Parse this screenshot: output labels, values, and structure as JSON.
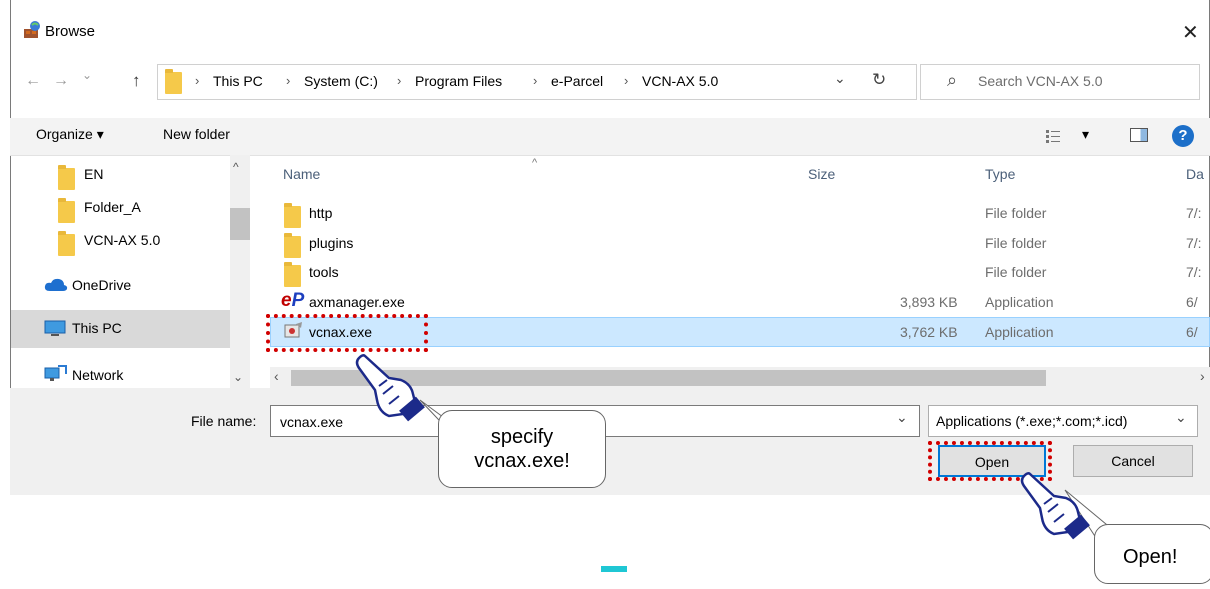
{
  "window": {
    "title": "Browse",
    "close_glyph": "✕"
  },
  "nav": {
    "back": "←",
    "forward": "→",
    "recent": "⌄",
    "up": "↑"
  },
  "breadcrumb": [
    "This PC",
    "System (C:)",
    "Program Files",
    "e-Parcel",
    "VCN-AX 5.0"
  ],
  "address_sep": "›",
  "address_dropdown": "⌄",
  "refresh_glyph": "↻",
  "search": {
    "placeholder": "Search VCN-AX 5.0",
    "icon": "⌕"
  },
  "toolbar": {
    "organize": "Organize ▾",
    "new_folder": "New folder",
    "view_arrow": "▾",
    "help": "?"
  },
  "sidebar": [
    {
      "label": "EN",
      "icon": "folder-icon"
    },
    {
      "label": "Folder_A",
      "icon": "folder-icon"
    },
    {
      "label": "VCN-AX 5.0",
      "icon": "folder-icon"
    },
    {
      "label": "OneDrive",
      "icon": "cloud-icon"
    },
    {
      "label": "This PC",
      "icon": "computer-icon"
    },
    {
      "label": "Network",
      "icon": "network-icon"
    }
  ],
  "columns": {
    "name": "Name",
    "size": "Size",
    "type": "Type",
    "date": "Da"
  },
  "files": [
    {
      "name": "http",
      "size": "",
      "type": "File folder",
      "date": "7/:"
    },
    {
      "name": "plugins",
      "size": "",
      "type": "File folder",
      "date": "7/:"
    },
    {
      "name": "tools",
      "size": "",
      "type": "File folder",
      "date": "7/:"
    },
    {
      "name": "axmanager.exe",
      "size": "3,893 KB",
      "type": "Application",
      "date": "6/"
    },
    {
      "name": "vcnax.exe",
      "size": "3,762 KB",
      "type": "Application",
      "date": "6/"
    }
  ],
  "filename": {
    "label": "File name:",
    "value": "vcnax.exe"
  },
  "filetype": {
    "value": "Applications (*.exe;*.com;*.icd)",
    "arrow": "⌄"
  },
  "buttons": {
    "open": "Open",
    "cancel": "Cancel"
  },
  "callouts": {
    "specify": "specify\nvcnax.exe!",
    "open": "Open!"
  },
  "colors": {
    "selection": "#cce8ff",
    "highlight_border": "#d10000",
    "accent": "#0078d7"
  }
}
